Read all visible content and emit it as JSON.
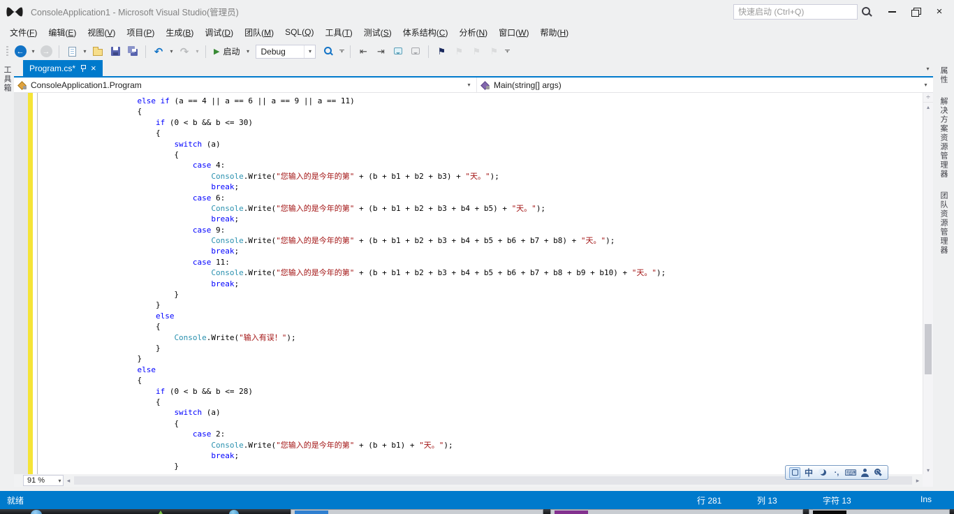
{
  "window": {
    "title": "ConsoleApplication1 - Microsoft Visual Studio(管理员)",
    "search_placeholder": "快速启动 (Ctrl+Q)"
  },
  "menu": {
    "items": [
      "文件(F)",
      "编辑(E)",
      "视图(V)",
      "项目(P)",
      "生成(B)",
      "调试(D)",
      "团队(M)",
      "SQL(Q)",
      "工具(T)",
      "测试(S)",
      "体系结构(C)",
      "分析(N)",
      "窗口(W)",
      "帮助(H)"
    ]
  },
  "toolbar": {
    "start_label": "启动",
    "config_value": "Debug"
  },
  "left_tabs": [
    {
      "label": "工具箱"
    }
  ],
  "right_tabs": [
    {
      "id": "properties",
      "label": "属性"
    },
    {
      "id": "solution-explorer",
      "label": "解决方案资源管理器"
    },
    {
      "id": "team-explorer",
      "label": "团队资源管理器"
    }
  ],
  "editor": {
    "tab": {
      "label": "Program.cs*"
    },
    "nav_left": "ConsoleApplication1.Program",
    "nav_right": "Main(string[] args)",
    "zoom": "91 %",
    "code": [
      [
        [
          "p",
          "                    "
        ],
        [
          "k",
          "else"
        ],
        [
          "p",
          " "
        ],
        [
          "k",
          "if"
        ],
        [
          "p",
          " (a == 4 || a == 6 || a == 9 || a == 11)"
        ]
      ],
      [
        [
          "p",
          "                    {"
        ]
      ],
      [
        [
          "p",
          "                        "
        ],
        [
          "k",
          "if"
        ],
        [
          "p",
          " (0 < b && b <= 30)"
        ]
      ],
      [
        [
          "p",
          "                        {"
        ]
      ],
      [
        [
          "p",
          "                            "
        ],
        [
          "k",
          "switch"
        ],
        [
          "p",
          " (a)"
        ]
      ],
      [
        [
          "p",
          "                            {"
        ]
      ],
      [
        [
          "p",
          "                                "
        ],
        [
          "k",
          "case"
        ],
        [
          "p",
          " 4:"
        ]
      ],
      [
        [
          "p",
          "                                    "
        ],
        [
          "t",
          "Console"
        ],
        [
          "p",
          ".Write("
        ],
        [
          "s",
          "\"您输入的是今年的第\""
        ],
        [
          "p",
          " + (b + b1 + b2 + b3) + "
        ],
        [
          "s",
          "\"天。\""
        ],
        [
          "p",
          ");"
        ]
      ],
      [
        [
          "p",
          "                                    "
        ],
        [
          "k",
          "break"
        ],
        [
          "p",
          ";"
        ]
      ],
      [
        [
          "p",
          "                                "
        ],
        [
          "k",
          "case"
        ],
        [
          "p",
          " 6:"
        ]
      ],
      [
        [
          "p",
          "                                    "
        ],
        [
          "t",
          "Console"
        ],
        [
          "p",
          ".Write("
        ],
        [
          "s",
          "\"您输入的是今年的第\""
        ],
        [
          "p",
          " + (b + b1 + b2 + b3 + b4 + b5) + "
        ],
        [
          "s",
          "\"天。\""
        ],
        [
          "p",
          ");"
        ]
      ],
      [
        [
          "p",
          "                                    "
        ],
        [
          "k",
          "break"
        ],
        [
          "p",
          ";"
        ]
      ],
      [
        [
          "p",
          "                                "
        ],
        [
          "k",
          "case"
        ],
        [
          "p",
          " 9:"
        ]
      ],
      [
        [
          "p",
          "                                    "
        ],
        [
          "t",
          "Console"
        ],
        [
          "p",
          ".Write("
        ],
        [
          "s",
          "\"您输入的是今年的第\""
        ],
        [
          "p",
          " + (b + b1 + b2 + b3 + b4 + b5 + b6 + b7 + b8) + "
        ],
        [
          "s",
          "\"天。\""
        ],
        [
          "p",
          ");"
        ]
      ],
      [
        [
          "p",
          "                                    "
        ],
        [
          "k",
          "break"
        ],
        [
          "p",
          ";"
        ]
      ],
      [
        [
          "p",
          "                                "
        ],
        [
          "k",
          "case"
        ],
        [
          "p",
          " 11:"
        ]
      ],
      [
        [
          "p",
          "                                    "
        ],
        [
          "t",
          "Console"
        ],
        [
          "p",
          ".Write("
        ],
        [
          "s",
          "\"您输入的是今年的第\""
        ],
        [
          "p",
          " + (b + b1 + b2 + b3 + b4 + b5 + b6 + b7 + b8 + b9 + b10) + "
        ],
        [
          "s",
          "\"天。\""
        ],
        [
          "p",
          ");"
        ]
      ],
      [
        [
          "p",
          "                                    "
        ],
        [
          "k",
          "break"
        ],
        [
          "p",
          ";"
        ]
      ],
      [
        [
          "p",
          "                            }"
        ]
      ],
      [
        [
          "p",
          "                        }"
        ]
      ],
      [
        [
          "p",
          "                        "
        ],
        [
          "k",
          "else"
        ]
      ],
      [
        [
          "p",
          "                        {"
        ]
      ],
      [
        [
          "p",
          "                            "
        ],
        [
          "t",
          "Console"
        ],
        [
          "p",
          ".Write("
        ],
        [
          "s",
          "\"输入有误！\""
        ],
        [
          "p",
          ");"
        ]
      ],
      [
        [
          "p",
          "                        }"
        ]
      ],
      [
        [
          "p",
          "                    }"
        ]
      ],
      [
        [
          "p",
          "                    "
        ],
        [
          "k",
          "else"
        ]
      ],
      [
        [
          "p",
          "                    {"
        ]
      ],
      [
        [
          "p",
          "                        "
        ],
        [
          "k",
          "if"
        ],
        [
          "p",
          " (0 < b && b <= 28)"
        ]
      ],
      [
        [
          "p",
          "                        {"
        ]
      ],
      [
        [
          "p",
          "                            "
        ],
        [
          "k",
          "switch"
        ],
        [
          "p",
          " (a)"
        ]
      ],
      [
        [
          "p",
          "                            {"
        ]
      ],
      [
        [
          "p",
          "                                "
        ],
        [
          "k",
          "case"
        ],
        [
          "p",
          " 2:"
        ]
      ],
      [
        [
          "p",
          "                                    "
        ],
        [
          "t",
          "Console"
        ],
        [
          "p",
          ".Write("
        ],
        [
          "s",
          "\"您输入的是今年的第\""
        ],
        [
          "p",
          " + (b + b1) + "
        ],
        [
          "s",
          "\"天。\""
        ],
        [
          "p",
          ");"
        ]
      ],
      [
        [
          "p",
          "                                    "
        ],
        [
          "k",
          "break"
        ],
        [
          "p",
          ";"
        ]
      ],
      [
        [
          "p",
          "                            }"
        ]
      ]
    ]
  },
  "status": {
    "ready": "就绪",
    "fields": [
      {
        "name": "line",
        "text": "行 281"
      },
      {
        "name": "column",
        "text": "列 13"
      },
      {
        "name": "character",
        "text": "字符 13"
      },
      {
        "name": "insert-mode",
        "text": "Ins"
      }
    ]
  },
  "ime": {
    "mode_label": "中"
  },
  "colors": {
    "accent": "#007ACC",
    "keyword": "#0000FF",
    "type": "#2B91AF",
    "string": "#A31515",
    "modified_line_bar": "#F5E437",
    "status_bar": "#007ACC"
  }
}
